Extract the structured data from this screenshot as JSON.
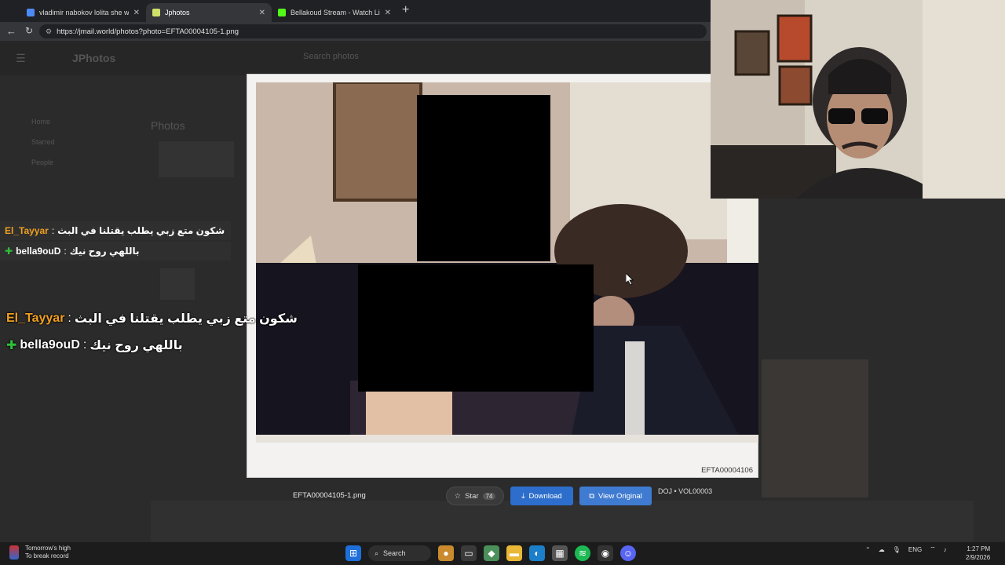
{
  "browser": {
    "tabs": [
      {
        "title": "vladimir nabokov lolita she was lo",
        "favicon_color": "#4c8bf5",
        "active": false
      },
      {
        "title": "Jphotos",
        "favicon_color": "#cfe06a",
        "active": true
      },
      {
        "title": "Bellakoud Stream - Watch Live on",
        "favicon_color": "#53fc18",
        "active": false
      }
    ],
    "url": "https://jmail.world/photos?photo=EFTA00004105-1.png"
  },
  "page": {
    "logo": "JPhotos",
    "search_placeholder": "Search photos",
    "nav_items": [
      "Home",
      "Starred",
      "People"
    ],
    "section_title": "Photos"
  },
  "lightbox": {
    "doc_id": "EFTA00004106",
    "filename": "EFTA00004105-1.png",
    "star_label": "Star",
    "star_count": "74",
    "download_label": "Download",
    "view_original_label": "View Original",
    "volume": "DOJ • VOL00003"
  },
  "chat": [
    {
      "user": "El_Tayyar",
      "message": "شكون متع زبي يطلب يقتلنا في البث"
    },
    {
      "user": "bella9ouD",
      "message": "باللهي روح نيك"
    },
    {
      "user": "El_Tayyar",
      "message": "شكون متع زبي يطلب يقتلنا في البث"
    },
    {
      "user": "bella9ouD",
      "message": "باللهي روح نيك"
    }
  ],
  "taskbar": {
    "weather_line1": "Tomorrow's high",
    "weather_line2": "To break record",
    "search_label": "Search",
    "language": "ENG",
    "time": "1:27 PM",
    "date": "2/9/2026"
  },
  "colors": {
    "download_blue": "#2d6ecc",
    "chat_user_orange": "#f0a020",
    "badge_green": "#2fbf3a"
  }
}
